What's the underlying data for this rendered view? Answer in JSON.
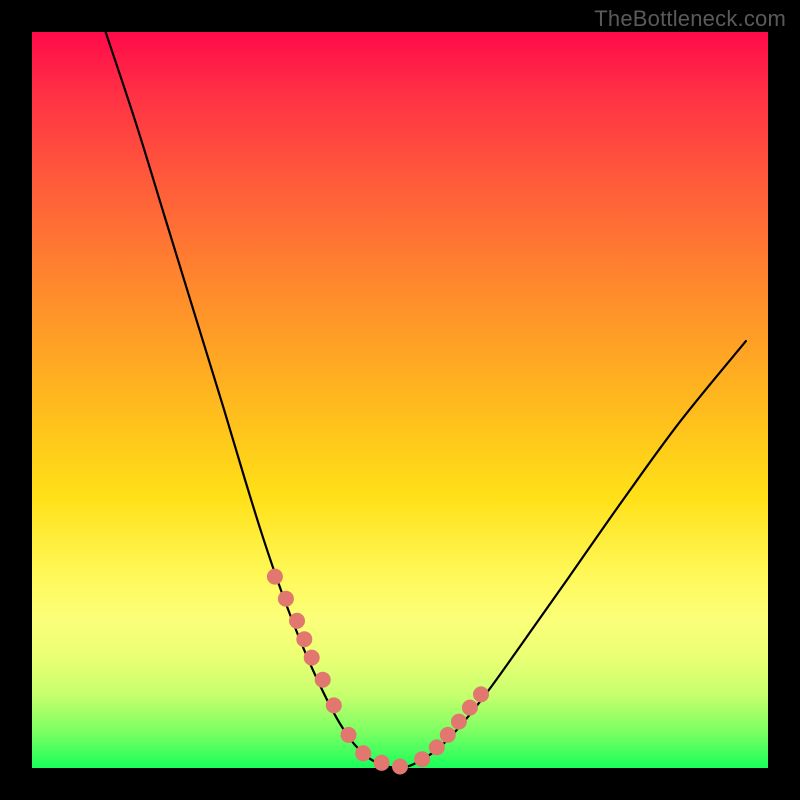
{
  "watermark": "TheBottleneck.com",
  "chart_data": {
    "type": "line",
    "title": "",
    "xlabel": "",
    "ylabel": "",
    "xlim": [
      0,
      100
    ],
    "ylim": [
      0,
      100
    ],
    "grid": false,
    "series": [
      {
        "name": "curve",
        "color": "#000000",
        "x": [
          10,
          14,
          18,
          22,
          26,
          29,
          31,
          33,
          35,
          37,
          39,
          41,
          42.5,
          44,
          46,
          48,
          50,
          52,
          55,
          58,
          62,
          67,
          73,
          80,
          88,
          97
        ],
        "values": [
          100,
          88,
          75,
          62,
          49,
          39,
          32.5,
          26.5,
          21,
          16,
          11.5,
          7.5,
          5,
          3,
          1.2,
          0.3,
          0,
          0.6,
          2.5,
          5.5,
          10.5,
          17.5,
          26,
          36,
          47,
          58
        ]
      },
      {
        "name": "markers",
        "color": "#e2776f",
        "type": "scatter",
        "x": [
          33,
          34.5,
          36,
          37,
          38,
          39.5,
          41,
          43,
          45,
          47.5,
          50,
          53,
          55,
          56.5,
          58,
          59.5,
          61
        ],
        "values": [
          26,
          23,
          20,
          17.5,
          15,
          12,
          8.5,
          4.5,
          2,
          0.7,
          0.2,
          1.2,
          2.8,
          4.5,
          6.3,
          8.2,
          10
        ]
      }
    ],
    "annotations": []
  }
}
